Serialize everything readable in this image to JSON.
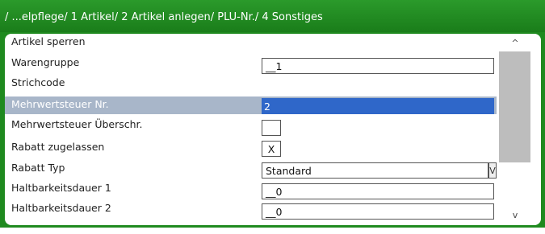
{
  "title": "/ ...elpflege/ 1 Artikel/ 2 Artikel anlegen/ PLU-Nr./ 4 Sonstiges",
  "rows": [
    {
      "label": "Artikel sperren"
    },
    {
      "label": "Warengruppe",
      "value": "__1"
    },
    {
      "label": "Strichcode"
    },
    {
      "label": "Mehrwertsteuer Nr.",
      "value": "2",
      "selected": true
    },
    {
      "label": "Mehrwertsteuer Überschr.",
      "value": ""
    },
    {
      "label": "Rabatt zugelassen",
      "value": "X"
    },
    {
      "label": "Rabatt Typ",
      "value": "Standard",
      "arrow": "V"
    },
    {
      "label": "Haltbarkeitsdauer 1",
      "value": "__0"
    },
    {
      "label": "Haltbarkeitsdauer 2",
      "value": "__0"
    }
  ],
  "scrollbar": {
    "up_icon": "chevron-up-icon",
    "down_icon": "chevron-down-icon",
    "up_glyph": "^",
    "down_glyph": "v"
  },
  "colors": {
    "frame": "#1f8a1f",
    "selection_row": "#a8b6c9",
    "active_field": "#2f67c9",
    "scroll_thumb": "#bdbdbd"
  }
}
